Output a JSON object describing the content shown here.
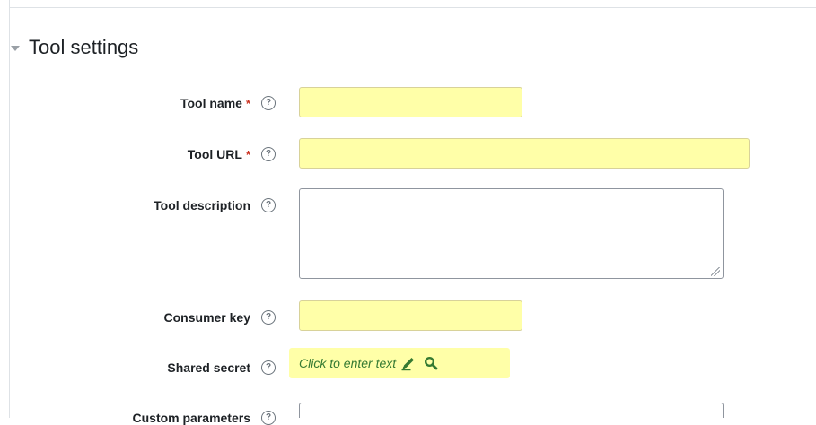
{
  "section": {
    "title": "Tool settings"
  },
  "fields": {
    "tool_name": {
      "label": "Tool name",
      "required_mark": "*",
      "help_glyph": "?",
      "value": ""
    },
    "tool_url": {
      "label": "Tool URL",
      "required_mark": "*",
      "help_glyph": "?",
      "value": ""
    },
    "tool_description": {
      "label": "Tool description",
      "help_glyph": "?",
      "value": ""
    },
    "consumer_key": {
      "label": "Consumer key",
      "help_glyph": "?",
      "value": ""
    },
    "shared_secret": {
      "label": "Shared secret",
      "help_glyph": "?",
      "placeholder": "Click to enter text"
    },
    "custom_parameters": {
      "label": "Custom parameters",
      "help_glyph": "?"
    }
  },
  "icons": {
    "collapse": "caret-down-icon",
    "help": "question-circle-icon",
    "edit": "pencil-icon",
    "reveal": "search-icon"
  },
  "colors": {
    "required": "#ca3120",
    "autofill_background": "#ffffa8",
    "inplace_text": "#357a32",
    "help_icon": "#6a737b"
  }
}
